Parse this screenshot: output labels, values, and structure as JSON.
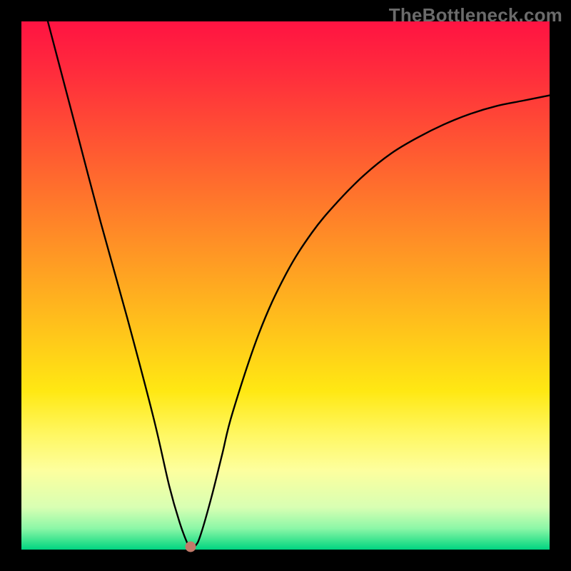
{
  "watermark": "TheBottleneck.com",
  "chart_data": {
    "type": "line",
    "title": "",
    "xlabel": "",
    "ylabel": "",
    "xlim": [
      0,
      100
    ],
    "ylim": [
      0,
      100
    ],
    "grid": false,
    "series": [
      {
        "name": "bottleneck-curve",
        "x": [
          5,
          10,
          15,
          20,
          25,
          28,
          30,
          31.5,
          32,
          33,
          34,
          36,
          38,
          40,
          45,
          50,
          55,
          60,
          65,
          70,
          75,
          80,
          85,
          90,
          95,
          100
        ],
        "y": [
          100,
          81,
          62,
          44,
          25,
          12,
          5,
          1,
          0.5,
          0.8,
          3,
          10,
          18,
          26,
          41,
          52,
          60,
          66,
          71,
          75,
          78,
          80.5,
          82.5,
          84,
          85,
          86
        ]
      }
    ],
    "minimum_marker": {
      "x": 32,
      "y": 0.5
    },
    "background_gradient_stops": [
      {
        "offset": 0.0,
        "color": "#ff1342"
      },
      {
        "offset": 0.1,
        "color": "#ff2d3c"
      },
      {
        "offset": 0.25,
        "color": "#ff5b31"
      },
      {
        "offset": 0.4,
        "color": "#ff8a27"
      },
      {
        "offset": 0.55,
        "color": "#ffb91d"
      },
      {
        "offset": 0.7,
        "color": "#ffe813"
      },
      {
        "offset": 0.78,
        "color": "#fff760"
      },
      {
        "offset": 0.85,
        "color": "#fdff9e"
      },
      {
        "offset": 0.92,
        "color": "#d8ffb3"
      },
      {
        "offset": 0.96,
        "color": "#8cf7a7"
      },
      {
        "offset": 0.985,
        "color": "#34e28d"
      },
      {
        "offset": 1.0,
        "color": "#00d482"
      }
    ]
  }
}
